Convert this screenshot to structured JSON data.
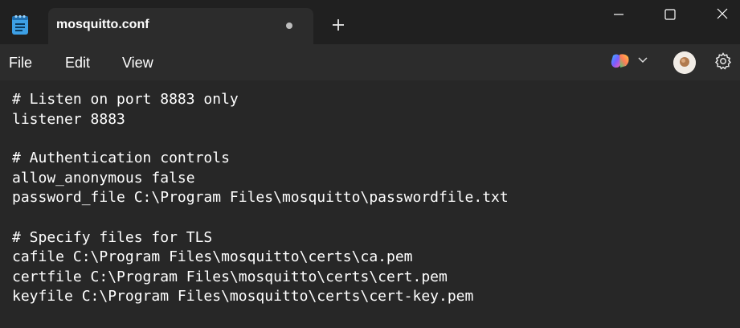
{
  "window": {
    "tab_title": "mosquitto.conf",
    "tab_modified": true,
    "app_icon": "notepad-icon",
    "new_tab_icon": "plus-icon",
    "controls": [
      "minimize-icon",
      "maximize-icon",
      "close-icon"
    ]
  },
  "menu": {
    "file": "File",
    "edit": "Edit",
    "view": "View"
  },
  "toolbar_right": {
    "copilot_icon": "copilot-icon",
    "chevron_icon": "chevron-down-icon",
    "avatar_icon": "avatar",
    "settings_icon": "gear-icon"
  },
  "editor": {
    "lines": [
      "# Listen on port 8883 only",
      "listener 8883",
      "",
      "# Authentication controls",
      "allow_anonymous false",
      "password_file C:\\Program Files\\mosquitto\\passwordfile.txt",
      "",
      "# Specify files for TLS",
      "cafile C:\\Program Files\\mosquitto\\certs\\ca.pem",
      "certfile C:\\Program Files\\mosquitto\\certs\\cert.pem",
      "keyfile C:\\Program Files\\mosquitto\\certs\\cert-key.pem"
    ]
  },
  "colors": {
    "titlebar": "#202020",
    "tab": "#2c2c2c",
    "editor": "#272727",
    "text": "#ffffff"
  }
}
